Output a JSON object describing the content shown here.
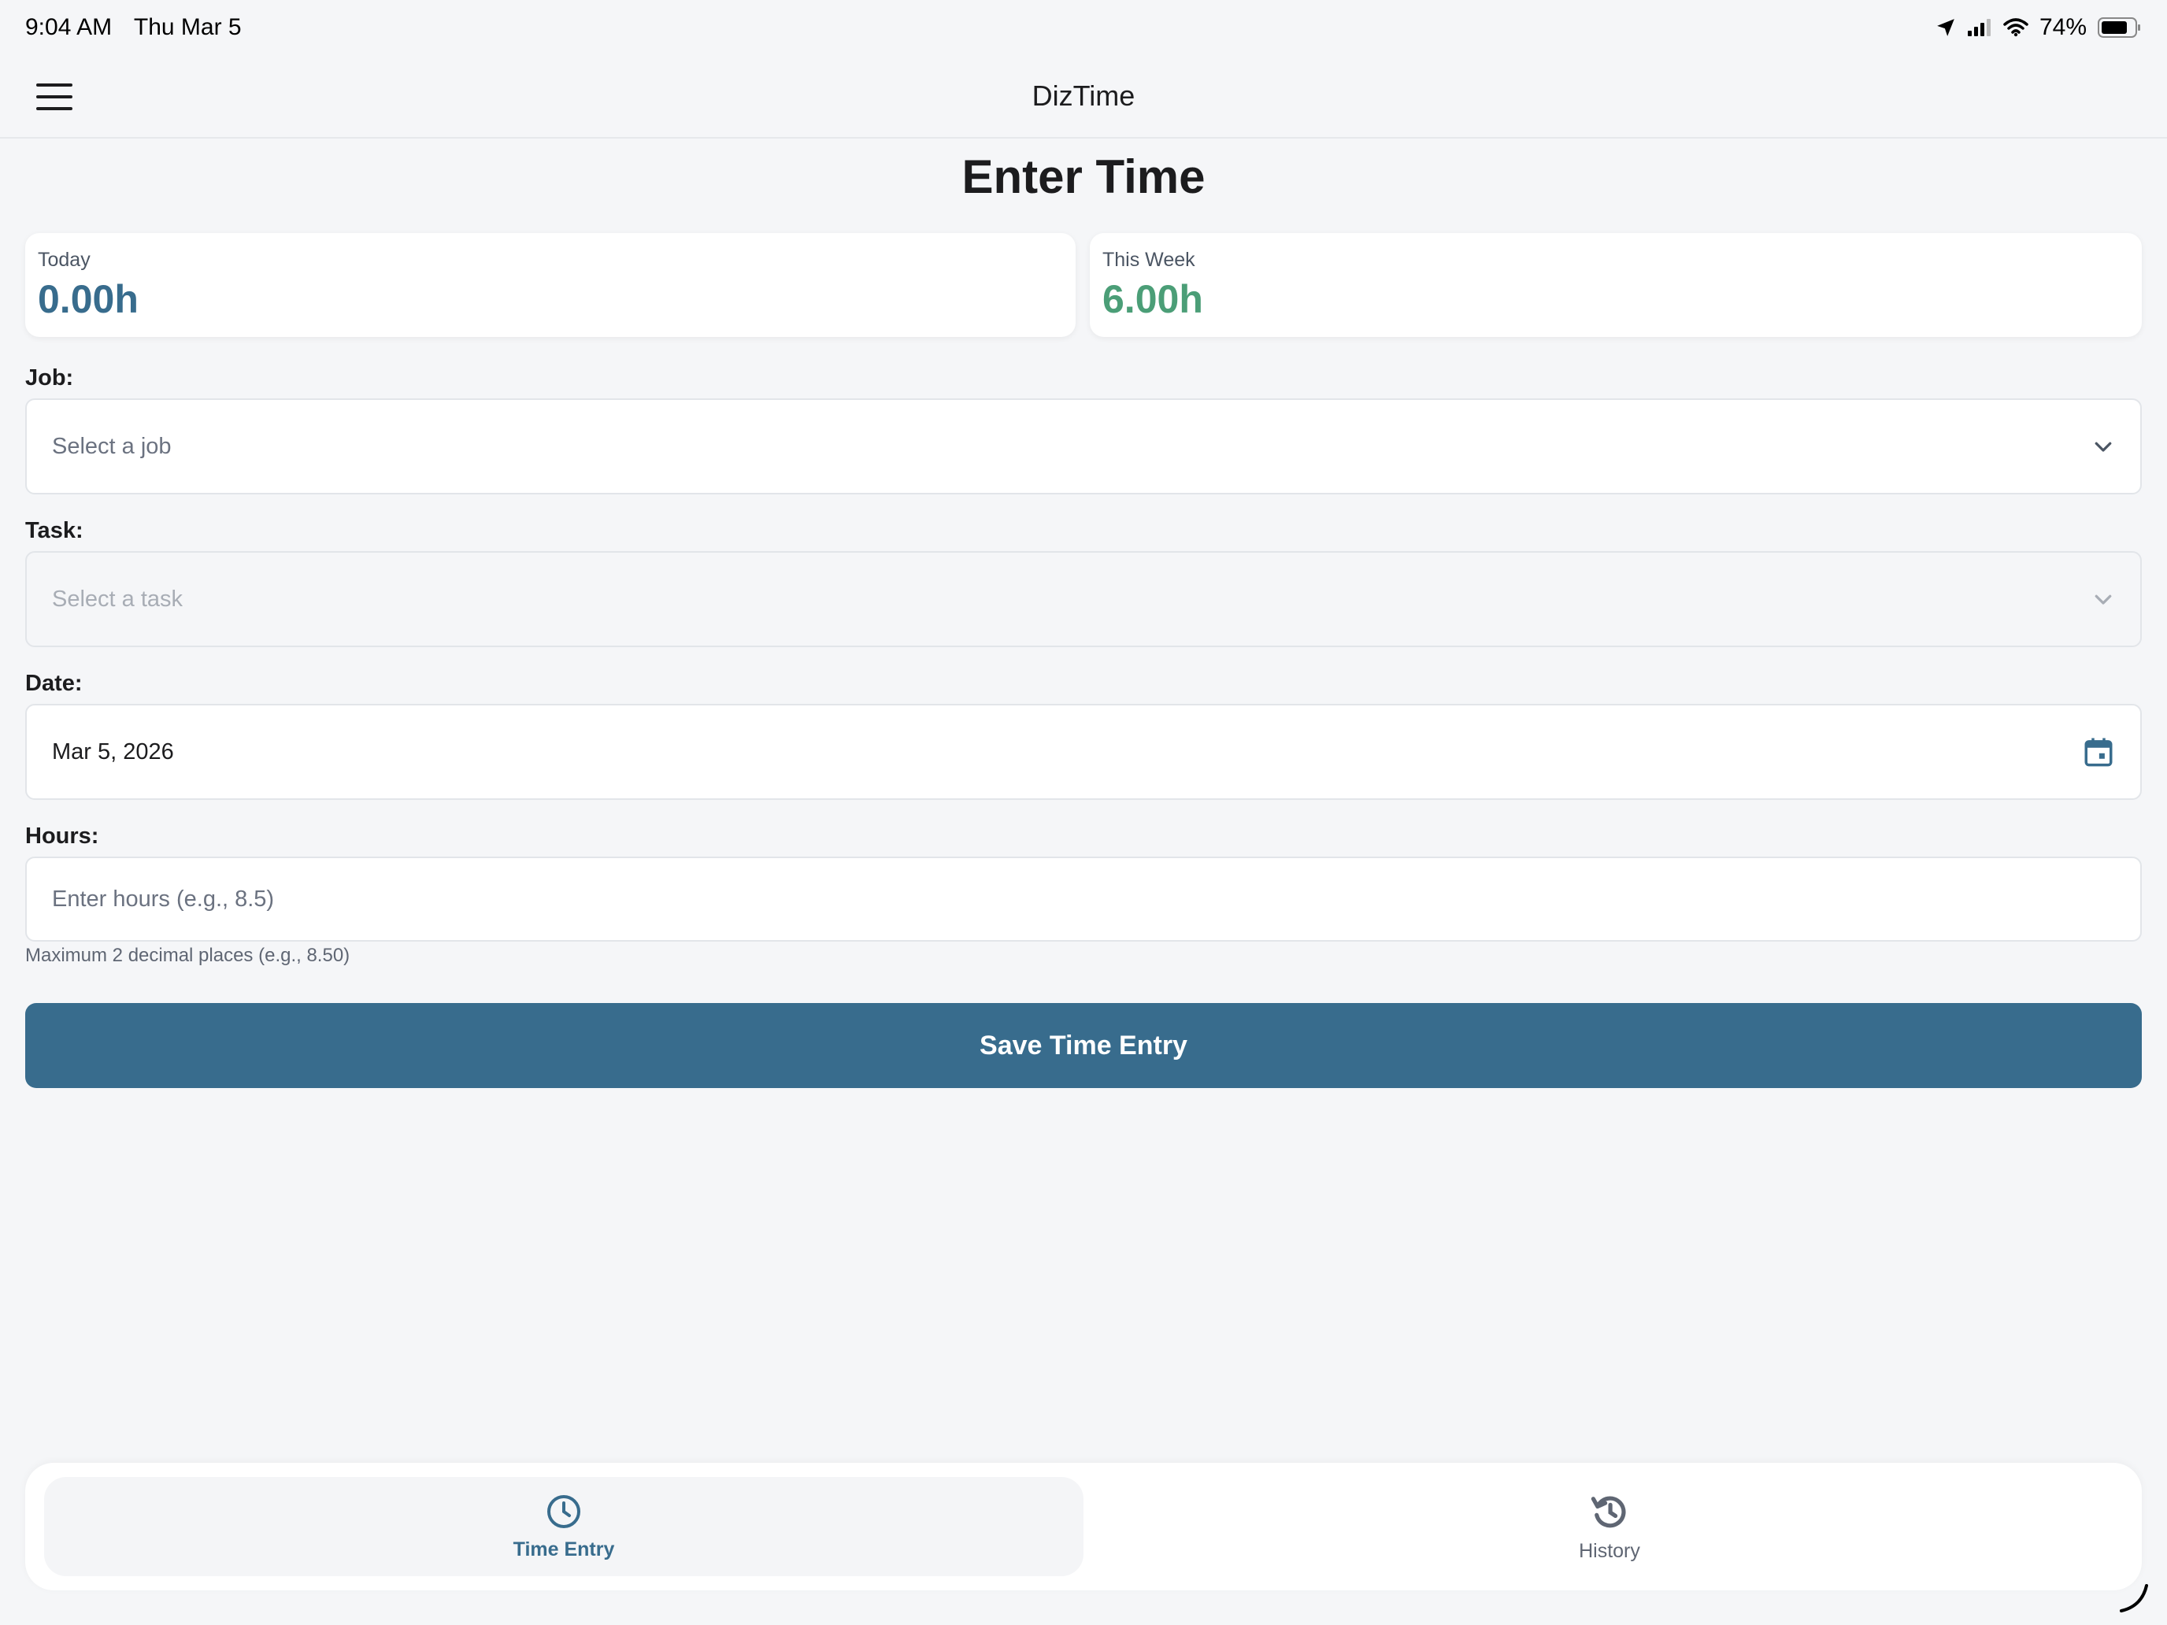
{
  "status_bar": {
    "time": "9:04 AM",
    "date": "Thu Mar 5",
    "battery": "74%"
  },
  "header": {
    "title": "DizTime"
  },
  "page": {
    "title": "Enter Time"
  },
  "stats": {
    "today": {
      "label": "Today",
      "value": "0.00h",
      "color": "#386c8d"
    },
    "week": {
      "label": "This Week",
      "value": "6.00h",
      "color": "#4b9e77"
    }
  },
  "form": {
    "job": {
      "label": "Job:",
      "placeholder": "Select a job"
    },
    "task": {
      "label": "Task:",
      "placeholder": "Select a task"
    },
    "date": {
      "label": "Date:",
      "value": "Mar 5, 2026"
    },
    "hours": {
      "label": "Hours:",
      "placeholder": "Enter hours (e.g., 8.5)",
      "hint": "Maximum 2 decimal places (e.g., 8.50)"
    },
    "save_label": "Save Time Entry"
  },
  "tabs": [
    {
      "label": "Time Entry",
      "icon": "clock-icon",
      "active": true
    },
    {
      "label": "History",
      "icon": "history-icon",
      "active": false
    }
  ],
  "colors": {
    "primary": "#386c8d",
    "accent_green": "#4b9e77"
  }
}
